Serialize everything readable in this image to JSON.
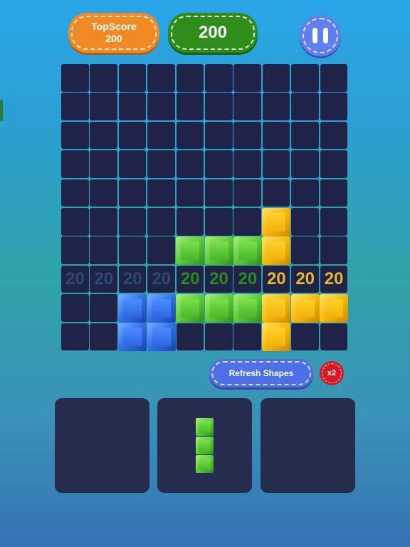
{
  "header": {
    "topscore_label": "TopScore",
    "topscore_value": "200",
    "score_value": "200"
  },
  "board": {
    "rows": 10,
    "cols": 10,
    "row_points": [
      "20",
      "20",
      "20",
      "20",
      "20",
      "20",
      "20",
      "20",
      "20",
      "20"
    ],
    "blocks": [
      {
        "r": 5,
        "c": 7,
        "color": "yellow"
      },
      {
        "r": 6,
        "c": 4,
        "color": "green"
      },
      {
        "r": 6,
        "c": 5,
        "color": "green"
      },
      {
        "r": 6,
        "c": 6,
        "color": "green"
      },
      {
        "r": 6,
        "c": 7,
        "color": "yellow"
      },
      {
        "r": 8,
        "c": 2,
        "color": "blue"
      },
      {
        "r": 8,
        "c": 3,
        "color": "blue"
      },
      {
        "r": 8,
        "c": 4,
        "color": "green"
      },
      {
        "r": 8,
        "c": 5,
        "color": "green"
      },
      {
        "r": 8,
        "c": 6,
        "color": "green"
      },
      {
        "r": 8,
        "c": 7,
        "color": "yellow"
      },
      {
        "r": 8,
        "c": 8,
        "color": "yellow"
      },
      {
        "r": 8,
        "c": 9,
        "color": "yellow"
      },
      {
        "r": 9,
        "c": 2,
        "color": "blue"
      },
      {
        "r": 9,
        "c": 3,
        "color": "blue"
      },
      {
        "r": 9,
        "c": 7,
        "color": "yellow"
      }
    ]
  },
  "controls": {
    "refresh_label": "Refresh Shapes",
    "multiplier": "x2"
  },
  "tray": {
    "slots": [
      {
        "shape": []
      },
      {
        "shape": [
          [
            0,
            0
          ],
          [
            1,
            0
          ],
          [
            2,
            0
          ]
        ],
        "color": "green"
      },
      {
        "shape": []
      }
    ]
  },
  "colors": {
    "green": "#5fc93a",
    "yellow": "#f7b90d",
    "blue": "#2f6ee8",
    "cell": "#1e2347"
  }
}
